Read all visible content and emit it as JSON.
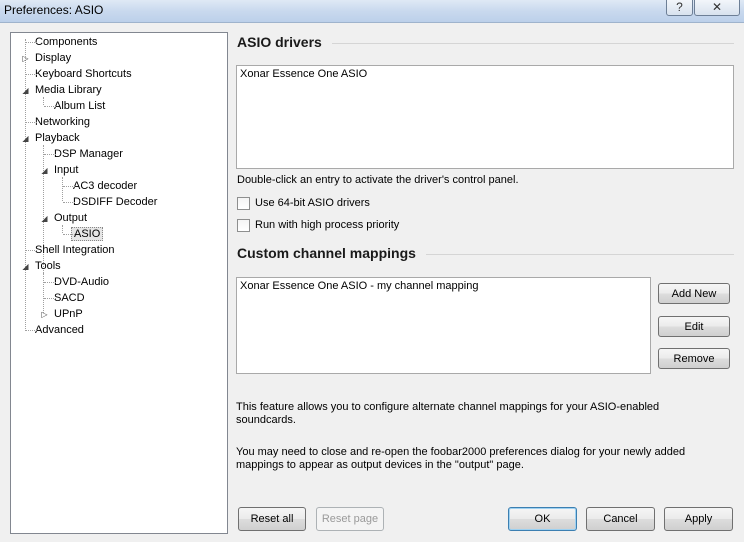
{
  "window": {
    "title": "Preferences: ASIO",
    "help_label": "?",
    "close_label": "✕"
  },
  "tree": {
    "items": [
      {
        "label": "Components",
        "expander": ""
      },
      {
        "label": "Display",
        "expander": "▷"
      },
      {
        "label": "Keyboard Shortcuts",
        "expander": ""
      },
      {
        "label": "Media Library",
        "expander": "◢"
      },
      {
        "label": "Album List",
        "expander": ""
      },
      {
        "label": "Networking",
        "expander": ""
      },
      {
        "label": "Playback",
        "expander": "◢"
      },
      {
        "label": "DSP Manager",
        "expander": ""
      },
      {
        "label": "Input",
        "expander": "◢"
      },
      {
        "label": "AC3 decoder",
        "expander": ""
      },
      {
        "label": "DSDIFF Decoder",
        "expander": ""
      },
      {
        "label": "Output",
        "expander": "◢"
      },
      {
        "label": "ASIO",
        "expander": ""
      },
      {
        "label": "Shell Integration",
        "expander": ""
      },
      {
        "label": "Tools",
        "expander": "◢"
      },
      {
        "label": "DVD-Audio",
        "expander": ""
      },
      {
        "label": "SACD",
        "expander": ""
      },
      {
        "label": "UPnP",
        "expander": "▷"
      },
      {
        "label": "Advanced",
        "expander": ""
      }
    ],
    "selected": "ASIO"
  },
  "asio_drivers": {
    "title": "ASIO drivers",
    "entries": [
      "Xonar Essence One ASIO"
    ],
    "hint": "Double-click an entry to activate the driver's control panel.",
    "use_64bit_label": "Use 64-bit ASIO drivers",
    "use_64bit_checked": false,
    "high_priority_label": "Run with high process priority",
    "high_priority_checked": false
  },
  "custom_mappings": {
    "title": "Custom channel mappings",
    "entries": [
      "Xonar Essence One ASIO - my channel mapping"
    ],
    "add_label": "Add New",
    "edit_label": "Edit",
    "remove_label": "Remove",
    "info1": "This feature allows you to configure alternate channel mappings for your ASIO-enabled soundcards.",
    "info2": "You may need to close and re-open the foobar2000 preferences dialog for your newly added mappings to appear as output devices in the \"output\" page."
  },
  "footer": {
    "reset_all": "Reset all",
    "reset_page": "Reset page",
    "ok": "OK",
    "cancel": "Cancel",
    "apply": "Apply"
  }
}
